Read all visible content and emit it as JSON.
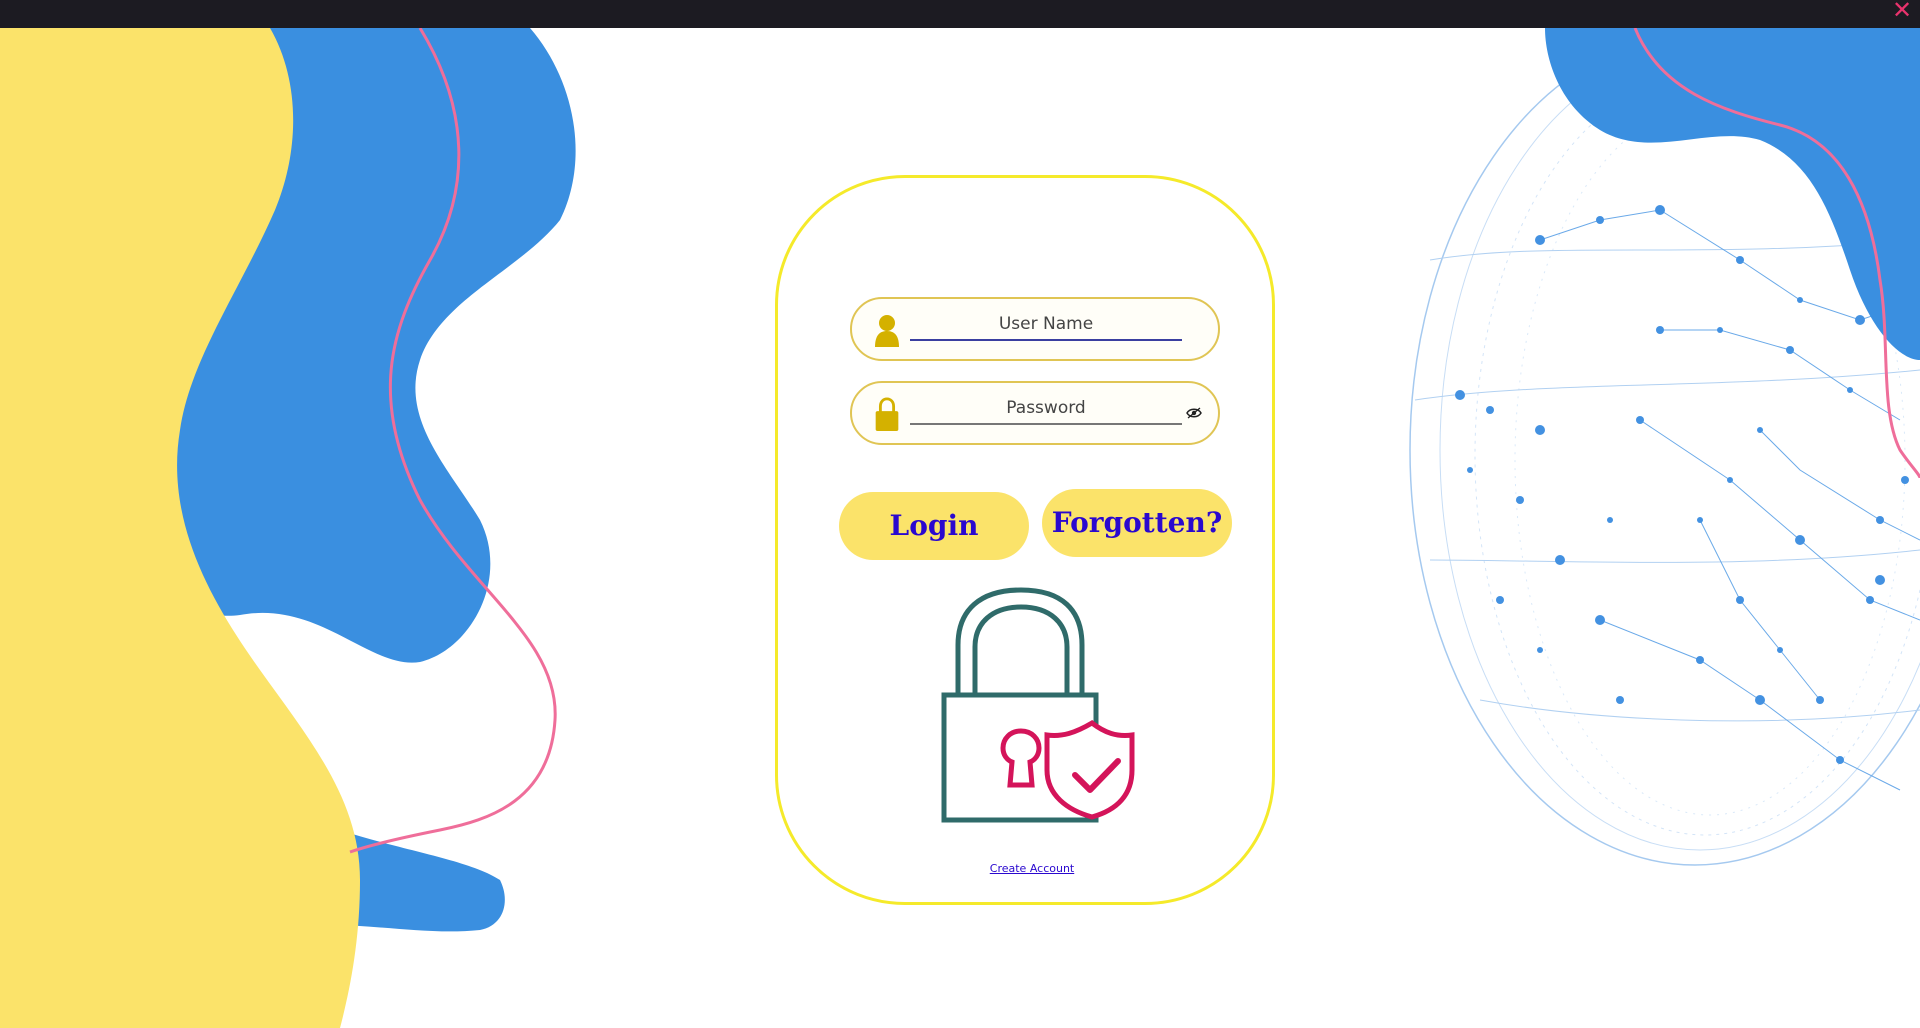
{
  "window": {
    "close_glyph": "✕"
  },
  "login_form": {
    "username": {
      "placeholder": "User Name",
      "value": "",
      "icon": "user-icon"
    },
    "password": {
      "placeholder": "Password",
      "value": "",
      "icon": "lock-icon",
      "toggle_icon": "eye-icon"
    },
    "login_label": "Login",
    "forgotten_label": "Forgotten?",
    "create_account_label": "Create Account"
  },
  "colors": {
    "titlebar": "#1c1b22",
    "close": "#e8336d",
    "blob_blue": "#3a8fe0",
    "blob_yellow": "#fbe36a",
    "accent_line": "#ef6e9a",
    "card_border": "#f5ea2a",
    "button_fill": "#fbe36a",
    "button_text": "#2a08cf",
    "lock_body": "#2f6b6a",
    "shield": "#d4145a"
  }
}
